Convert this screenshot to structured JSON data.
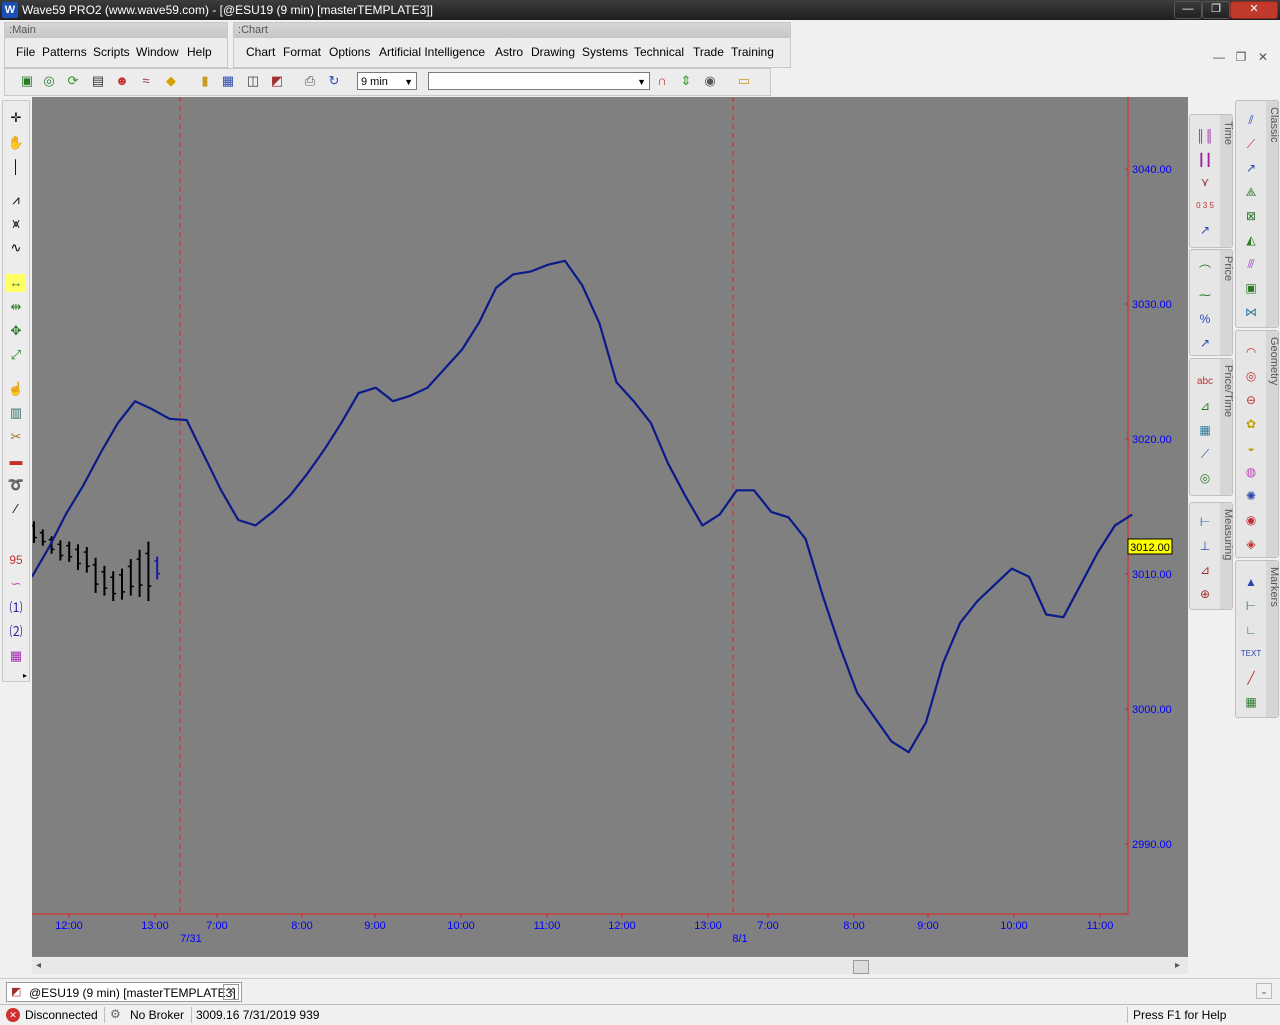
{
  "window": {
    "title": "Wave59 PRO2 (www.wave59.com) - [@ESU19 (9 min) [masterTEMPLATE3]]",
    "logo_letter": "W",
    "minimize_glyph": "—",
    "restore_glyph": "❐",
    "close_glyph": "✕"
  },
  "bands": {
    "main_title": "Main",
    "chart_title": "Chart"
  },
  "main_menu": [
    {
      "label": "File"
    },
    {
      "label": "Patterns"
    },
    {
      "label": "Scripts"
    },
    {
      "label": "Window"
    },
    {
      "label": "Help"
    }
  ],
  "chart_menu": [
    {
      "label": "Chart"
    },
    {
      "label": "Format"
    },
    {
      "label": "Options"
    },
    {
      "label": "Artificial Intelligence"
    },
    {
      "label": "Astro"
    },
    {
      "label": "Drawing"
    },
    {
      "label": "Systems"
    },
    {
      "label": "Technical"
    },
    {
      "label": "Trade"
    },
    {
      "label": "Training"
    }
  ],
  "toolbar": {
    "interval_value": "9 min",
    "symbol_value": ""
  },
  "palettes": {
    "time": "Time",
    "price": "Price",
    "price_time": "Price/Time",
    "measuring": "Measuring",
    "classic": "Classic",
    "geometry": "Geometry",
    "markers": "Markers",
    "text_icon": "TEXT",
    "abc_icon": "abc",
    "fib_icon": "0 3 5",
    "counter_icon": "95"
  },
  "chart_data": {
    "type": "line",
    "y_axis_labels": [
      "3040.00",
      "3030.00",
      "3020.00",
      "3010.00",
      "3000.00",
      "2990.00"
    ],
    "y_axis_values": [
      3040,
      3030,
      3020,
      3010,
      3000,
      2990
    ],
    "x_axis_labels": [
      "12:00",
      "13:00",
      "7:00",
      "8:00",
      "9:00",
      "10:00",
      "11:00",
      "12:00",
      "13:00",
      "7:00",
      "8:00",
      "9:00",
      "10:00",
      "11:00"
    ],
    "date_labels": [
      "7/31",
      "8/1"
    ],
    "last_price_label": "3012.00",
    "last_price": 3012.0,
    "colors": {
      "background": "#808080",
      "line": "#0a1a8a",
      "axis_text": "#0000ff",
      "session_divider": "#e02020",
      "price_marker_bg": "#ffff00"
    },
    "series": [
      {
        "values": [
          3009.8,
          3012.0,
          3014.5,
          3016.6,
          3019.0,
          3021.2,
          3022.8,
          3022.2,
          3021.5,
          3021.4,
          3018.8,
          3016.2,
          3014.0,
          3013.6,
          3014.6,
          3015.8,
          3017.4,
          3019.2,
          3021.2,
          3023.4,
          3023.8,
          3022.8,
          3023.2,
          3023.8,
          3025.2,
          3026.6,
          3028.6,
          3031.2,
          3032.2,
          3032.4,
          3032.9,
          3033.2,
          3031.4,
          3028.6,
          3024.2,
          3022.8,
          3021.2,
          3018.2,
          3015.8,
          3013.6,
          3014.4,
          3016.2,
          3016.2,
          3014.6,
          3014.2,
          3012.6,
          3008.4,
          3004.6,
          3001.2,
          2999.4,
          2997.6,
          2996.8,
          2999.0,
          3003.4,
          3006.4,
          3008.0,
          3009.2,
          3010.4,
          3009.8,
          3007.0,
          3006.8,
          3009.2,
          3011.6,
          3013.6,
          3014.4
        ]
      }
    ],
    "ohlc_bars": [
      {
        "high": 3013.9,
        "low": 3012.3
      },
      {
        "high": 3013.3,
        "low": 3012.1
      },
      {
        "high": 3012.8,
        "low": 3011.5
      },
      {
        "high": 3012.5,
        "low": 3011.0
      },
      {
        "high": 3012.4,
        "low": 3010.9
      },
      {
        "high": 3012.2,
        "low": 3010.3
      },
      {
        "high": 3012.0,
        "low": 3010.1
      },
      {
        "high": 3011.2,
        "low": 3008.6
      },
      {
        "high": 3010.6,
        "low": 3008.4
      },
      {
        "high": 3010.2,
        "low": 3008.0
      },
      {
        "high": 3010.4,
        "low": 3008.1
      },
      {
        "high": 3011.1,
        "low": 3008.4
      },
      {
        "high": 3011.8,
        "low": 3008.3
      },
      {
        "high": 3012.4,
        "low": 3008.0
      },
      {
        "high": 3011.3,
        "low": 3009.6
      }
    ],
    "y_range": [
      2985,
      3045
    ],
    "grid": false
  },
  "document_tab": {
    "label": "@ESU19 (9 min) [masterTEMPLATE3]"
  },
  "status": {
    "connection": "Disconnected",
    "broker": "No Broker",
    "quote": "3009.16  7/31/2019  939",
    "help": "Press F1 for Help"
  }
}
